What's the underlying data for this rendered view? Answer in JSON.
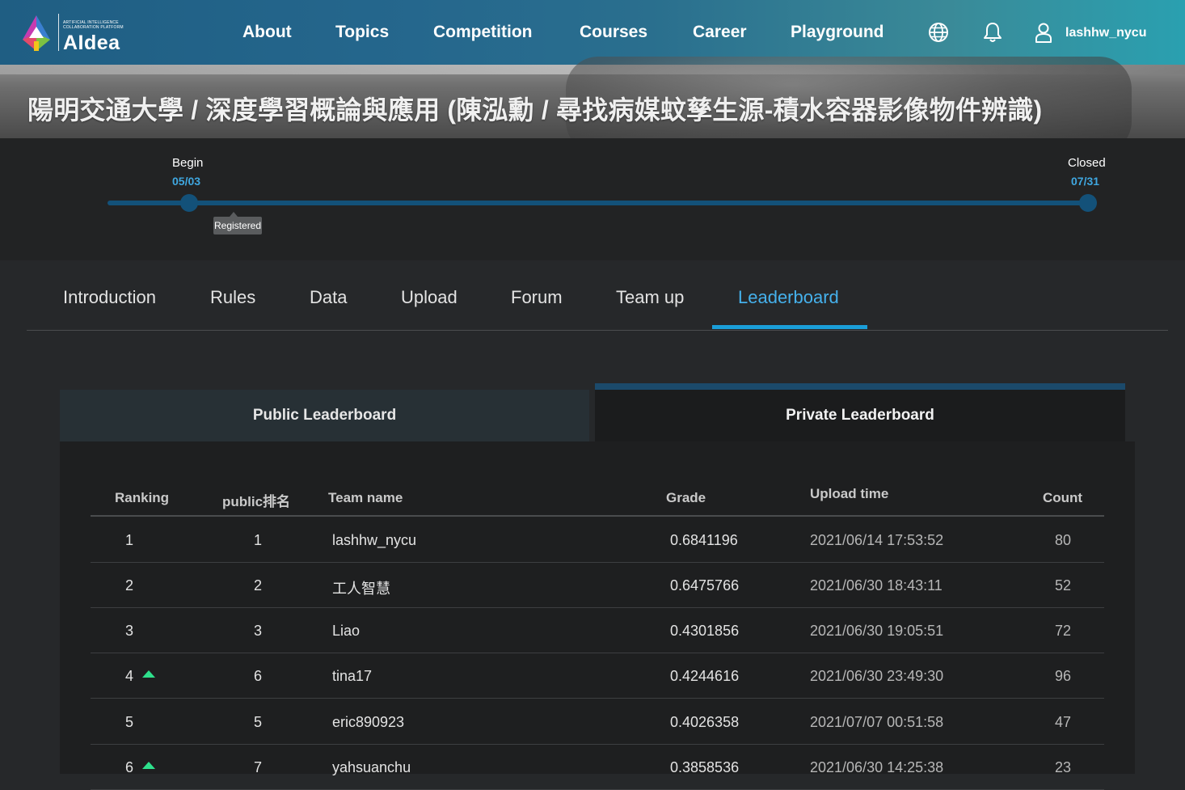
{
  "nav": {
    "brand_small": "ARTIFICIAL INTELLIGENCE COLLABORATION PLATFORM",
    "brand": "AIdea",
    "links": [
      "About",
      "Topics",
      "Competition",
      "Courses",
      "Career",
      "Playground"
    ],
    "icons": [
      "globe-icon",
      "bell-icon",
      "user-icon"
    ],
    "username": "lashhw_nycu"
  },
  "page_title": "陽明交通大學 / 深度學習概論與應用 (陳泓勳 / 尋找病媒蚊孳生源-積水容器影像物件辨識)",
  "timeline": {
    "begin_label": "Begin",
    "begin_date": "05/03",
    "end_label": "Closed",
    "end_date": "07/31",
    "registered_label": "Registered"
  },
  "tabs": [
    "Introduction",
    "Rules",
    "Data",
    "Upload",
    "Forum",
    "Team up",
    "Leaderboard"
  ],
  "active_tab": "Leaderboard",
  "leaderboard": {
    "public_label": "Public Leaderboard",
    "private_label": "Private Leaderboard",
    "columns": [
      "Ranking",
      "public排名",
      "Team name",
      "Grade",
      "Upload time",
      "Count"
    ],
    "rows": [
      {
        "rank": "1",
        "public_rank": "1",
        "team": "lashhw_nycu",
        "grade": "0.6841196",
        "time": "2021/06/14 17:53:52",
        "count": "80",
        "moved_up": false
      },
      {
        "rank": "2",
        "public_rank": "2",
        "team": "工人智慧",
        "grade": "0.6475766",
        "time": "2021/06/30 18:43:11",
        "count": "52",
        "moved_up": false
      },
      {
        "rank": "3",
        "public_rank": "3",
        "team": "Liao",
        "grade": "0.4301856",
        "time": "2021/06/30 19:05:51",
        "count": "72",
        "moved_up": false
      },
      {
        "rank": "4",
        "public_rank": "6",
        "team": "tina17",
        "grade": "0.4244616",
        "time": "2021/06/30 23:49:30",
        "count": "96",
        "moved_up": true
      },
      {
        "rank": "5",
        "public_rank": "5",
        "team": "eric890923",
        "grade": "0.4026358",
        "time": "2021/07/07 00:51:58",
        "count": "47",
        "moved_up": false
      },
      {
        "rank": "6",
        "public_rank": "7",
        "team": "yahsuanchu",
        "grade": "0.3858536",
        "time": "2021/06/30 14:25:38",
        "count": "23",
        "moved_up": true
      }
    ]
  },
  "colors": {
    "accent": "#45b1ec",
    "track": "#135179",
    "up_arrow": "#2ee08c"
  }
}
